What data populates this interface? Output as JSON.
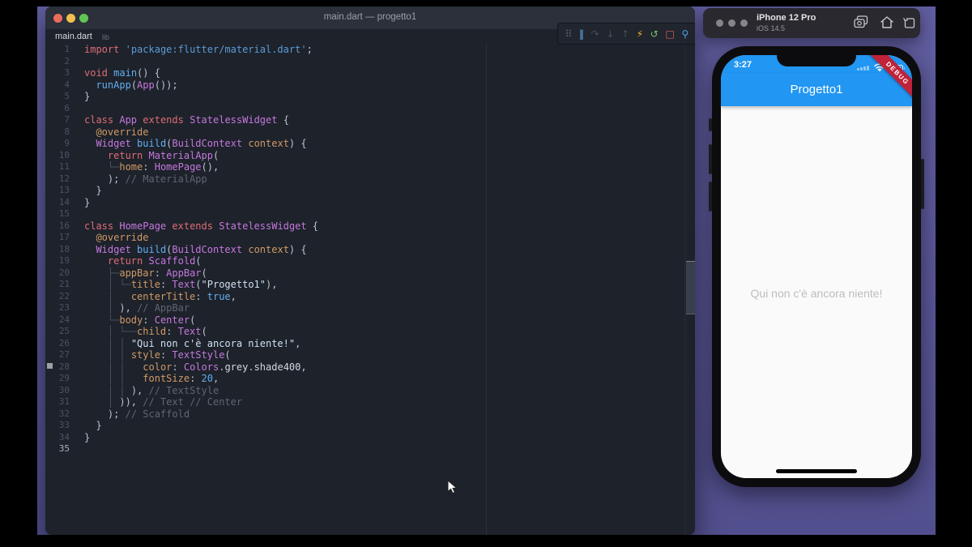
{
  "colors": {
    "desktop_purple": "#5c599b",
    "editor_bg": "#1d222b",
    "titlebar_bg": "#2b303a",
    "traffic_red": "#ec6a5e",
    "traffic_yellow": "#f4bf4f",
    "traffic_green": "#61c554",
    "flutter_blue": "#2196f3",
    "debug_banner_red": "#c0223a",
    "body_text_grey": "#bdbdbd",
    "keyword": "#e06c75",
    "type": "#c678dd",
    "function": "#61afef",
    "parameter": "#d19a66",
    "comment": "#5f6672"
  },
  "vscode": {
    "window_title": "main.dart — progetto1",
    "tab": {
      "file": "main.dart",
      "dir": "lib"
    },
    "debug_toolbar": [
      {
        "name": "drag-handle-icon",
        "glyph": "⠿",
        "color": "#5b6372"
      },
      {
        "name": "pause-icon",
        "glyph": "‖",
        "color": "#61afef"
      },
      {
        "name": "step-over-icon",
        "glyph": "↷",
        "color": "#49505c"
      },
      {
        "name": "step-into-icon",
        "glyph": "↓",
        "color": "#49505c"
      },
      {
        "name": "step-out-icon",
        "glyph": "↑",
        "color": "#49505c"
      },
      {
        "name": "hot-reload-icon",
        "glyph": "⚡",
        "color": "#f0b429"
      },
      {
        "name": "hot-restart-icon",
        "glyph": "↺",
        "color": "#7cbf6b"
      },
      {
        "name": "stop-icon",
        "glyph": "□",
        "color": "#e0635c"
      },
      {
        "name": "inspector-icon",
        "glyph": "⚲",
        "color": "#4da3e0"
      }
    ],
    "code": [
      {
        "n": 1,
        "s": [
          [
            "kw",
            "import"
          ],
          [
            "pl",
            " "
          ],
          [
            "sti",
            "'package:flutter/material.dart'"
          ],
          [
            "pl",
            ";"
          ]
        ]
      },
      {
        "n": 2,
        "s": []
      },
      {
        "n": 3,
        "s": [
          [
            "kw",
            "void"
          ],
          [
            "pl",
            " "
          ],
          [
            "fn",
            "main"
          ],
          [
            "pl",
            "() {"
          ]
        ]
      },
      {
        "n": 4,
        "s": [
          [
            "pl",
            "  "
          ],
          [
            "fn",
            "runApp"
          ],
          [
            "pl",
            "("
          ],
          [
            "ty",
            "App"
          ],
          [
            "pl",
            "());"
          ]
        ]
      },
      {
        "n": 5,
        "s": [
          [
            "pl",
            "}"
          ]
        ]
      },
      {
        "n": 6,
        "s": []
      },
      {
        "n": 7,
        "s": [
          [
            "kw",
            "class"
          ],
          [
            "pl",
            " "
          ],
          [
            "ty",
            "App"
          ],
          [
            "pl",
            " "
          ],
          [
            "kw",
            "extends"
          ],
          [
            "pl",
            " "
          ],
          [
            "ty",
            "StatelessWidget"
          ],
          [
            "pl",
            " {"
          ]
        ]
      },
      {
        "n": 8,
        "s": [
          [
            "pl",
            "  "
          ],
          [
            "an",
            "@override"
          ]
        ]
      },
      {
        "n": 9,
        "s": [
          [
            "pl",
            "  "
          ],
          [
            "ty",
            "Widget"
          ],
          [
            "pl",
            " "
          ],
          [
            "fn",
            "build"
          ],
          [
            "pl",
            "("
          ],
          [
            "ty",
            "BuildContext"
          ],
          [
            "pl",
            " "
          ],
          [
            "pr",
            "context"
          ],
          [
            "pl",
            ") {"
          ]
        ]
      },
      {
        "n": 10,
        "s": [
          [
            "pl",
            "    "
          ],
          [
            "kw",
            "return"
          ],
          [
            "pl",
            " "
          ],
          [
            "ty",
            "MaterialApp"
          ],
          [
            "pl",
            "("
          ]
        ]
      },
      {
        "n": 11,
        "s": [
          [
            "pl",
            "    "
          ],
          [
            "gd",
            "└─"
          ],
          [
            "pr",
            "home"
          ],
          [
            "pl",
            ": "
          ],
          [
            "ty",
            "HomePage"
          ],
          [
            "pl",
            "(),"
          ]
        ]
      },
      {
        "n": 12,
        "s": [
          [
            "pl",
            "    );"
          ],
          [
            "cm",
            " // MaterialApp"
          ]
        ]
      },
      {
        "n": 13,
        "s": [
          [
            "pl",
            "  }"
          ]
        ]
      },
      {
        "n": 14,
        "s": [
          [
            "pl",
            "}"
          ]
        ]
      },
      {
        "n": 15,
        "s": []
      },
      {
        "n": 16,
        "s": [
          [
            "kw",
            "class"
          ],
          [
            "pl",
            " "
          ],
          [
            "ty",
            "HomePage"
          ],
          [
            "pl",
            " "
          ],
          [
            "kw",
            "extends"
          ],
          [
            "pl",
            " "
          ],
          [
            "ty",
            "StatelessWidget"
          ],
          [
            "pl",
            " {"
          ]
        ]
      },
      {
        "n": 17,
        "s": [
          [
            "pl",
            "  "
          ],
          [
            "an",
            "@override"
          ]
        ]
      },
      {
        "n": 18,
        "s": [
          [
            "pl",
            "  "
          ],
          [
            "ty",
            "Widget"
          ],
          [
            "pl",
            " "
          ],
          [
            "fn",
            "build"
          ],
          [
            "pl",
            "("
          ],
          [
            "ty",
            "BuildContext"
          ],
          [
            "pl",
            " "
          ],
          [
            "pr",
            "context"
          ],
          [
            "pl",
            ") {"
          ]
        ]
      },
      {
        "n": 19,
        "s": [
          [
            "pl",
            "    "
          ],
          [
            "kw",
            "return"
          ],
          [
            "pl",
            " "
          ],
          [
            "ty",
            "Scaffold"
          ],
          [
            "pl",
            "("
          ]
        ]
      },
      {
        "n": 20,
        "s": [
          [
            "pl",
            "    "
          ],
          [
            "gd",
            "├─"
          ],
          [
            "pr",
            "appBar"
          ],
          [
            "pl",
            ": "
          ],
          [
            "ty",
            "AppBar"
          ],
          [
            "pl",
            "("
          ]
        ]
      },
      {
        "n": 21,
        "s": [
          [
            "pl",
            "    "
          ],
          [
            "gd",
            "│ └─"
          ],
          [
            "pr",
            "title"
          ],
          [
            "pl",
            ": "
          ],
          [
            "ty",
            "Text"
          ],
          [
            "pl",
            "("
          ],
          [
            "st",
            "\"Progetto1\""
          ],
          [
            "pl",
            "),"
          ]
        ]
      },
      {
        "n": 22,
        "s": [
          [
            "pl",
            "    "
          ],
          [
            "gd",
            "│   "
          ],
          [
            "pr",
            "centerTitle"
          ],
          [
            "pl",
            ": "
          ],
          [
            "cn",
            "true"
          ],
          [
            "pl",
            ","
          ]
        ]
      },
      {
        "n": 23,
        "s": [
          [
            "pl",
            "    "
          ],
          [
            "gd",
            "│ "
          ],
          [
            "pl",
            "),"
          ],
          [
            "cm",
            " // AppBar"
          ]
        ]
      },
      {
        "n": 24,
        "s": [
          [
            "pl",
            "    "
          ],
          [
            "gd",
            "└─"
          ],
          [
            "pr",
            "body"
          ],
          [
            "pl",
            ": "
          ],
          [
            "ty",
            "Center"
          ],
          [
            "pl",
            "("
          ]
        ]
      },
      {
        "n": 25,
        "s": [
          [
            "pl",
            "    "
          ],
          [
            "gd",
            "│ └──"
          ],
          [
            "pr",
            "child"
          ],
          [
            "pl",
            ": "
          ],
          [
            "ty",
            "Text"
          ],
          [
            "pl",
            "("
          ]
        ]
      },
      {
        "n": 26,
        "s": [
          [
            "pl",
            "    "
          ],
          [
            "gd",
            "│ │ "
          ],
          [
            "st",
            "\"Qui non c'è ancora niente!\""
          ],
          [
            "pl",
            ","
          ]
        ]
      },
      {
        "n": 27,
        "s": [
          [
            "pl",
            "    "
          ],
          [
            "gd",
            "│ │ "
          ],
          [
            "pr",
            "style"
          ],
          [
            "pl",
            ": "
          ],
          [
            "ty",
            "TextStyle"
          ],
          [
            "pl",
            "("
          ]
        ]
      },
      {
        "n": 28,
        "s": [
          [
            "pl",
            "    "
          ],
          [
            "gd",
            "│ │   "
          ],
          [
            "pr",
            "color"
          ],
          [
            "pl",
            ": "
          ],
          [
            "ty",
            "Colors"
          ],
          [
            "pl",
            "."
          ],
          [
            "id",
            "grey"
          ],
          [
            "pl",
            "."
          ],
          [
            "id",
            "shade400"
          ],
          [
            "pl",
            ","
          ]
        ]
      },
      {
        "n": 29,
        "s": [
          [
            "pl",
            "    "
          ],
          [
            "gd",
            "│ │   "
          ],
          [
            "pr",
            "fontSize"
          ],
          [
            "pl",
            ": "
          ],
          [
            "cn",
            "20"
          ],
          [
            "pl",
            ","
          ]
        ]
      },
      {
        "n": 30,
        "s": [
          [
            "pl",
            "    "
          ],
          [
            "gd",
            "│ │ "
          ],
          [
            "pl",
            "),"
          ],
          [
            "cm",
            " // TextStyle"
          ]
        ]
      },
      {
        "n": 31,
        "s": [
          [
            "pl",
            "    "
          ],
          [
            "gd",
            "│ "
          ],
          [
            "pl",
            ")),"
          ],
          [
            "cm",
            " // Text // Center"
          ]
        ]
      },
      {
        "n": 32,
        "s": [
          [
            "pl",
            "    );"
          ],
          [
            "cm",
            " // Scaffold"
          ]
        ]
      },
      {
        "n": 33,
        "s": [
          [
            "pl",
            "  }"
          ]
        ]
      },
      {
        "n": 34,
        "s": [
          [
            "pl",
            "}"
          ]
        ]
      },
      {
        "n": 35,
        "s": []
      }
    ],
    "active_line": 35
  },
  "simulator": {
    "device": "iPhone 12 Pro",
    "os": "iOS 14.5",
    "titlebar_icons": [
      "screenshot-icon",
      "home-icon",
      "rotate-icon"
    ],
    "app": {
      "time": "3:27",
      "appbar_title": "Progetto1",
      "body_text": "Qui non c'è ancora niente!",
      "debug_banner": "DEBUG"
    }
  }
}
